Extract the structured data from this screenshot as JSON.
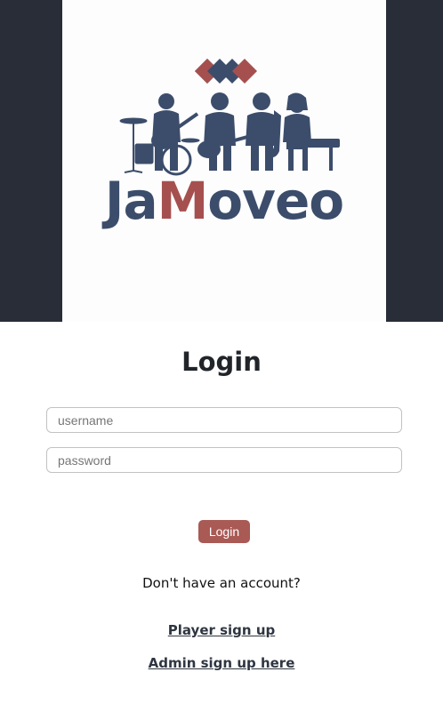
{
  "app": {
    "brand_prefix": "Ja",
    "brand_accent": "M",
    "brand_suffix": "oveo",
    "colors": {
      "dark_navy": "#3c4d6b",
      "brand_red": "#a5504f",
      "side_panel": "#282d38",
      "button": "#a95a55"
    }
  },
  "login": {
    "title": "Login",
    "username_placeholder": "username",
    "password_placeholder": "password",
    "submit_label": "Login",
    "no_account_text": "Don't have an account?",
    "player_signup_label": "Player sign up",
    "admin_signup_label": "Admin sign up here"
  },
  "icons": {
    "logo_mark": "diamond-pattern-icon",
    "band": "band-illustration"
  }
}
